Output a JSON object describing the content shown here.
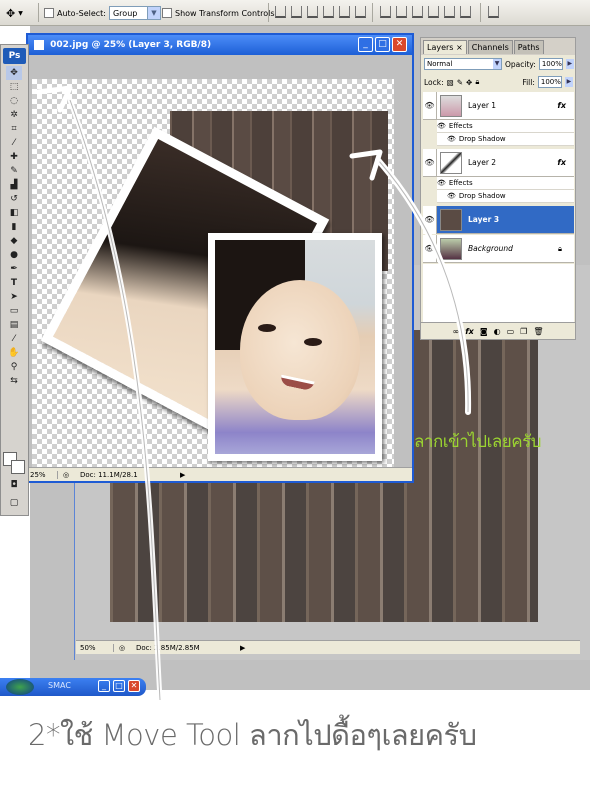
{
  "options_bar": {
    "auto_select_label": "Auto-Select:",
    "auto_select_value": "Group",
    "show_transform_label": "Show Transform Controls"
  },
  "toolbox": {
    "logo": "Ps",
    "tools": [
      "move-tool",
      "marquee-tool",
      "lasso-tool",
      "magic-wand-tool",
      "crop-tool",
      "eyedropper-tool",
      "healing-tool",
      "brush-tool",
      "clone-stamp-tool",
      "history-brush-tool",
      "eraser-tool",
      "gradient-tool",
      "blur-tool",
      "dodge-tool",
      "pen-tool",
      "type-tool",
      "path-selection-tool",
      "shape-tool",
      "notes-tool",
      "eyedropper2-tool",
      "hand-tool",
      "zoom-tool"
    ]
  },
  "front_window": {
    "title": "002.jpg @ 25% (Layer 3, RGB/8)",
    "zoom": "25%",
    "doc_size": "Doc: 11.1M/28.1"
  },
  "back_window": {
    "zoom": "50%",
    "doc_size": "Doc: 2.85M/2.85M"
  },
  "layers_panel": {
    "tabs": [
      "Layers",
      "Channels",
      "Paths"
    ],
    "blend_mode": "Normal",
    "opacity_label": "Opacity:",
    "opacity_value": "100%",
    "lock_label": "Lock:",
    "fill_label": "Fill:",
    "fill_value": "100%",
    "layers": [
      {
        "name": "Layer 1",
        "has_fx": true,
        "effects_label": "Effects",
        "effect": "Drop Shadow",
        "selected": false
      },
      {
        "name": "Layer 2",
        "has_fx": true,
        "effects_label": "Effects",
        "effect": "Drop Shadow",
        "selected": false
      },
      {
        "name": "Layer 3",
        "has_fx": false,
        "selected": true
      },
      {
        "name": "Background",
        "has_fx": false,
        "selected": false,
        "locked": true
      }
    ],
    "fx_label": "fx"
  },
  "taskbar": {
    "label": "SMAC"
  },
  "annotations": {
    "drag_in": "ลากเข้าไปเลยครับ",
    "instruction": "2*ใช้ Move Tool ลากไปดื้อๆเลยครับ"
  },
  "colors": {
    "title_blue": "#1d5fd6",
    "selection_blue": "#316ac5",
    "annotation_green": "#9bd431"
  }
}
